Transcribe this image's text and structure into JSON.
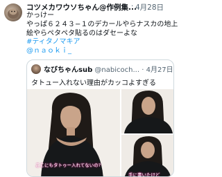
{
  "post": {
    "author_name": "コツメカワウソちゃん@作例集...",
    "separator": "·",
    "date": "4月28日",
    "lines": [
      "かっけー",
      "やっぱ６２４３−１のデカールやらナスカの地上",
      "絵やらペタペタ貼るのはダセーよな"
    ],
    "hashtag": "#ティタノマキア",
    "mention": "@ｎａｏｋｉ_"
  },
  "quote": {
    "author_name": "なびちゃんsub",
    "handle": "@nabicoch...",
    "separator": "·",
    "date": "4月27日",
    "text": "タトュー入れない理由がカッコよすぎる",
    "video_caption_left": "ここにもタトゥー入れてないの?",
    "video_caption_right": "手に書いたけど"
  }
}
